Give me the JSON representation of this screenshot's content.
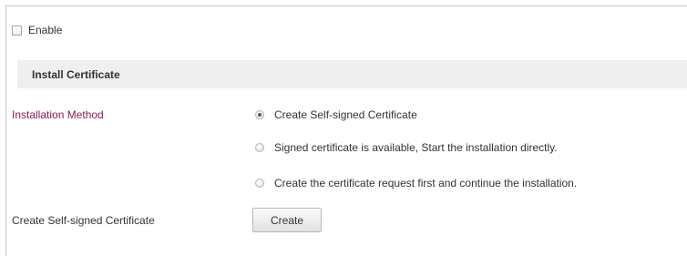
{
  "enable": {
    "label": "Enable",
    "checked": false
  },
  "section": {
    "title": "Install Certificate"
  },
  "installation_method": {
    "label": "Installation Method",
    "label_color": "#8a1e55",
    "options": [
      {
        "label": "Create Self-signed Certificate",
        "selected": true
      },
      {
        "label": "Signed certificate is available, Start the installation directly.",
        "selected": false
      },
      {
        "label": "Create the certificate request first and continue the installation.",
        "selected": false
      }
    ]
  },
  "self_signed": {
    "label": "Create Self-signed Certificate",
    "button_label": "Create"
  }
}
